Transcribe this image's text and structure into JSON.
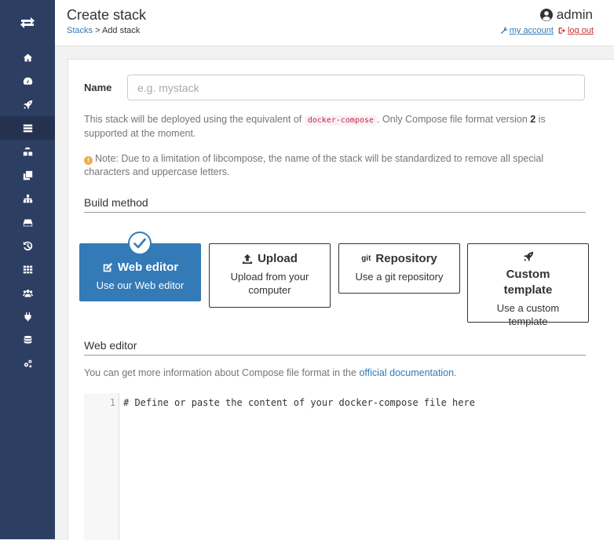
{
  "header": {
    "title": "Create stack",
    "breadcrumb": {
      "parent": "Stacks",
      "separator": " > ",
      "current": "Add stack"
    },
    "user": "admin",
    "my_account": "my account",
    "log_out": "log out"
  },
  "sidebar": {
    "items": [
      {
        "icon": "home-icon"
      },
      {
        "icon": "dashboard-icon"
      },
      {
        "icon": "rocket-icon"
      },
      {
        "icon": "stacks-icon",
        "active": true
      },
      {
        "icon": "services-icon"
      },
      {
        "icon": "containers-icon"
      },
      {
        "icon": "network-icon"
      },
      {
        "icon": "volumes-icon"
      },
      {
        "icon": "history-icon"
      },
      {
        "icon": "templates-icon"
      },
      {
        "icon": "users-icon"
      },
      {
        "icon": "endpoints-icon"
      },
      {
        "icon": "registries-icon"
      },
      {
        "icon": "settings-icon"
      }
    ]
  },
  "form": {
    "name_label": "Name",
    "name_placeholder": "e.g. mystack",
    "name_value": "",
    "deploy_note": {
      "prefix": "This stack will be deployed using the equivalent of ",
      "code": "docker-compose",
      "middle": ". Only Compose file format version ",
      "version": "2",
      "suffix": " is supported at the moment."
    },
    "warning_note": "Note: Due to a limitation of libcompose, the name of the stack will be standardized to remove all special characters and uppercase letters."
  },
  "build_method": {
    "title": "Build method",
    "options": [
      {
        "title": "Web editor",
        "description": "Use our Web editor",
        "icon": "edit-icon",
        "selected": true
      },
      {
        "title": "Upload",
        "description": "Upload from your computer",
        "icon": "upload-icon",
        "selected": false
      },
      {
        "title": "Repository",
        "description": "Use a git repository",
        "icon": "git-icon",
        "icon_text": "git",
        "selected": false
      },
      {
        "title": "Custom template",
        "description": "Use a custom template",
        "icon": "rocket-icon",
        "selected": false
      }
    ]
  },
  "web_editor": {
    "title": "Web editor",
    "info_prefix": "You can get more information about Compose file format in the ",
    "info_link": "official documentation",
    "info_suffix": ".",
    "line_number": "1",
    "content": "# Define or paste the content of your docker-compose file here"
  },
  "colors": {
    "sidebar": "#2d3e63",
    "accent": "#337ab7",
    "logout": "#c9302c"
  }
}
